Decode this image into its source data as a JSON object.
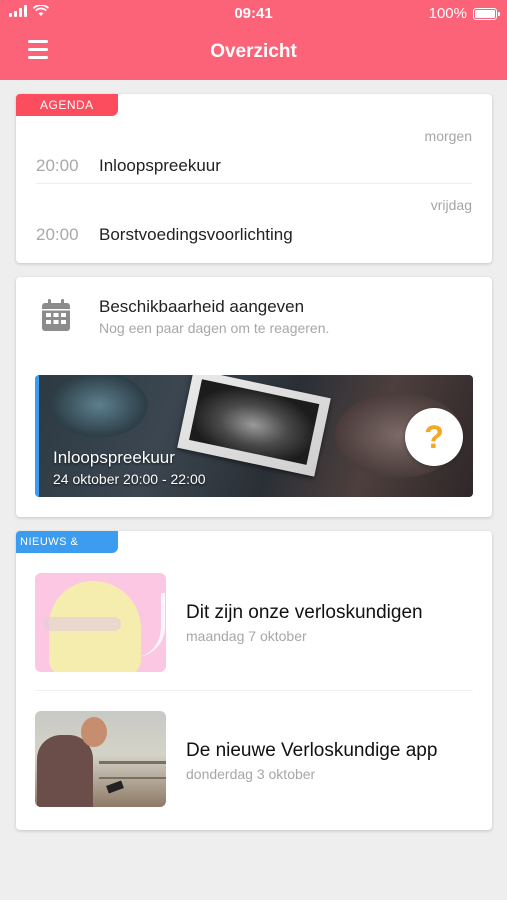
{
  "status_bar": {
    "time": "09:41",
    "battery": "100%",
    "signal_icon": "signal-bars-icon",
    "wifi_icon": "wifi-icon",
    "battery_icon": "battery-full-icon"
  },
  "header": {
    "title": "Overzicht",
    "menu_icon": "hamburger-menu-icon",
    "color": "#fc6378"
  },
  "agenda": {
    "tag": "AGENDA",
    "tag_color": "#fc4d5e",
    "items": [
      {
        "day": "morgen",
        "time": "20:00",
        "name": "Inloopspreekuur"
      },
      {
        "day": "vrijdag",
        "time": "20:00",
        "name": "Borstvoedingsvoorlichting"
      }
    ]
  },
  "availability": {
    "icon": "calendar-icon",
    "title": "Beschikbaarheid aangeven",
    "subtitle": "Nog een paar dagen om te reageren.",
    "event": {
      "name": "Inloopspreekuur",
      "date": "24 oktober 20:00 - 22:00",
      "question_icon": "?"
    }
  },
  "news": {
    "tag": "NIEUWS & BLOGS",
    "tag_color": "#3b9cf0",
    "items": [
      {
        "title": "Dit zijn onze verloskundigen",
        "date": "maandag 7 oktober"
      },
      {
        "title": "De nieuwe Verloskundige app",
        "date": "donderdag 3 oktober"
      }
    ]
  }
}
